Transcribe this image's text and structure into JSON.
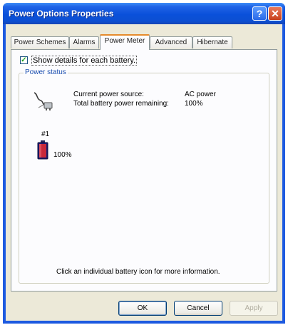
{
  "window": {
    "title": "Power Options Properties",
    "help_label": "?",
    "close_label": "✕"
  },
  "tabs": [
    {
      "label": "Power Schemes",
      "active": false
    },
    {
      "label": "Alarms",
      "active": false
    },
    {
      "label": "Power Meter",
      "active": true
    },
    {
      "label": "Advanced",
      "active": false
    },
    {
      "label": "Hibernate",
      "active": false
    }
  ],
  "power_meter": {
    "show_details_label": "Show details for each battery.",
    "show_details_checked": true,
    "group_label": "Power status",
    "current_source_label": "Current power source:",
    "current_source_value": "AC power",
    "battery_remaining_label": "Total battery power remaining:",
    "battery_remaining_value": "100%",
    "battery": {
      "number": "#1",
      "percent": "100%",
      "level": 1.0
    },
    "info_text": "Click an individual battery icon for more information."
  },
  "buttons": {
    "ok": "OK",
    "cancel": "Cancel",
    "apply": "Apply"
  },
  "icons": {
    "plug": "power-plug-icon",
    "battery": "battery-icon",
    "check": "✓"
  }
}
